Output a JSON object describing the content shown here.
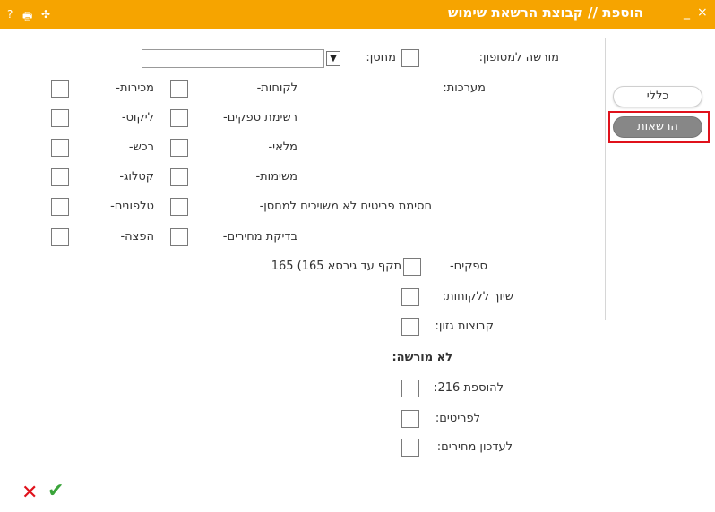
{
  "window": {
    "title": "הוספת // קבוצת הרשאת שימוש",
    "close_glyph": "×",
    "minimize_glyph": "_",
    "help_glyph": "?",
    "print_glyph": "🖶",
    "move_glyph": "✣"
  },
  "sidebar": {
    "general_label": "כללי",
    "permissions_label": "הרשאות"
  },
  "form": {
    "allowed_to_terminal": "מורשה למסופון:",
    "warehouse_label": "מחסן:",
    "warehouse_value": "",
    "systems_label": "מערכות:",
    "customers": "לקוחות-",
    "sales": "מכירות-",
    "suppliers_list": "רשימת ספקים-",
    "picking": "ליקוט-",
    "inventory": "מלאי-",
    "purchase": "רכש-",
    "tasks": "משימות-",
    "catalog": "קטלוג-",
    "block_items": "חסימת פריטים לא משויכים למחסן-",
    "phones": "טלפונים-",
    "price_check": "בדיקת מחירים-",
    "distribution": "הפצה-",
    "suppliers": "ספקים-",
    "suppliers_note": "(תקף עד גירסא 165",
    "assign_customers": "שיוך ללקוחות:",
    "cut_groups": "קבוצות גזון:",
    "not_allowed": "לא מורשה:",
    "add_216": "להוספת 216:",
    "for_items": "לפריטים:",
    "update_prices": "לעדכון מחירים:"
  },
  "actions": {
    "cancel_glyph": "✕",
    "ok_glyph": "✔"
  }
}
